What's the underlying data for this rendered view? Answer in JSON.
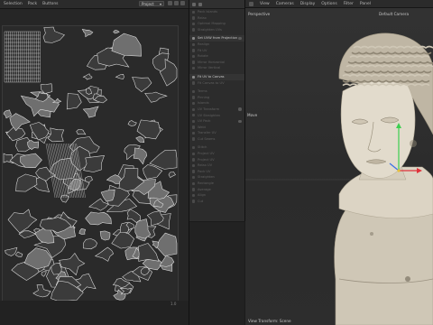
{
  "uv_editor": {
    "menu": [
      "Selection",
      "Pack",
      "Buttons"
    ],
    "dropdown_value": "Project",
    "zoom_label": "1.0"
  },
  "command_panel": {
    "items": [
      {
        "label": "Pack Islands",
        "active": false
      },
      {
        "label": "Relax",
        "active": false
      },
      {
        "label": "Optimal Mapping",
        "active": false
      },
      {
        "label": "Straighten UVs",
        "active": false
      },
      {
        "label": "Set UVW from Projection",
        "active": true,
        "badge": true
      },
      {
        "label": "Realign",
        "active": false
      },
      {
        "label": "Fit UV",
        "active": false
      },
      {
        "label": "Rotate",
        "active": false
      },
      {
        "label": "Mirror Horizontal",
        "active": false
      },
      {
        "label": "Mirror Vertical",
        "active": false
      },
      {
        "label": "Fit UV to Canvas",
        "active": true
      },
      {
        "label": "Fit Canvas to UV",
        "active": false
      },
      {
        "label": "Terms",
        "active": false
      },
      {
        "label": "Pinning",
        "active": false
      },
      {
        "label": "Islands",
        "active": false
      },
      {
        "label": "UV Transform",
        "active": false,
        "badge": true
      },
      {
        "label": "UV Straighten",
        "active": false
      },
      {
        "label": "UV Pack",
        "active": false,
        "badge": true
      },
      {
        "label": "Weld",
        "active": false
      },
      {
        "label": "Transfer UV",
        "active": false
      },
      {
        "label": "Cut Seams",
        "active": false
      },
      {
        "label": "Stitch",
        "active": false
      },
      {
        "label": "Project UV",
        "active": false
      },
      {
        "label": "Project UV",
        "active": false
      },
      {
        "label": "Relax UV",
        "active": false
      },
      {
        "label": "Pack UV",
        "active": false
      },
      {
        "label": "Straighten",
        "active": false
      },
      {
        "label": "Rectangle",
        "active": false
      },
      {
        "label": "Average",
        "active": false
      },
      {
        "label": "Align",
        "active": false
      },
      {
        "label": "Cut",
        "active": false
      }
    ]
  },
  "viewport": {
    "menu": [
      "View",
      "Cameras",
      "Display",
      "Options",
      "Filter",
      "Panel"
    ],
    "view_name": "Perspective",
    "camera_name": "Default Camera",
    "move_label": "Move",
    "transform_label": "View Transform: Scene",
    "colors": {
      "axis_x": "#e0323a",
      "axis_y": "#3ccf4f",
      "axis_z": "#3a6fe8",
      "marble": "#d9d2c4"
    }
  }
}
